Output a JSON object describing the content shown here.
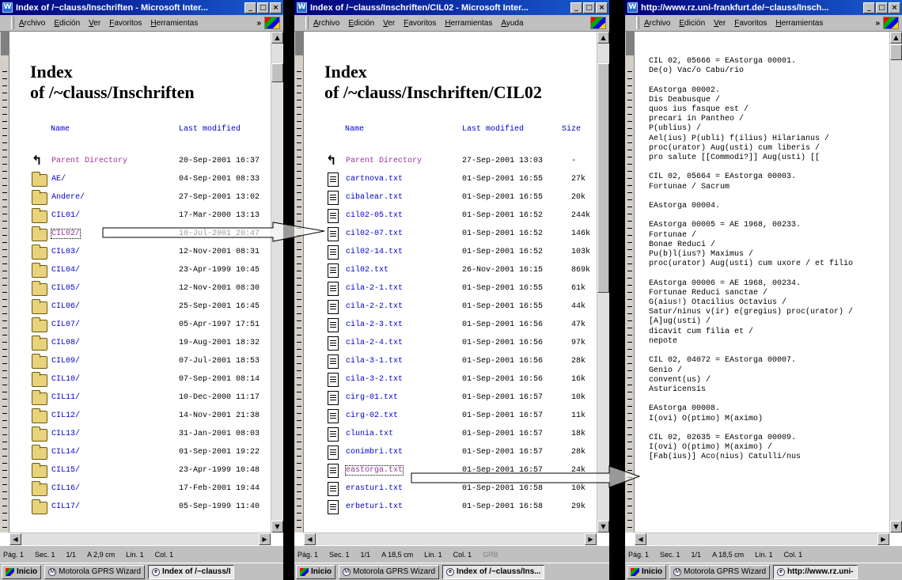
{
  "windows": [
    {
      "title": "Index of /~clauss/Inschriften - Microsoft Inter...",
      "menu": [
        "Archivo",
        "Edición",
        "Ver",
        "Favoritos",
        "Herramientas",
        "»"
      ],
      "heading1": "Index",
      "heading2": "of /~clauss/Inschriften",
      "col_name": "Name",
      "col_modified": "Last modified",
      "rows": [
        {
          "icon": "back",
          "name": "Parent Directory",
          "date": "20-Sep-2001 16:37"
        },
        {
          "icon": "folder",
          "name": "AE/",
          "date": "04-Sep-2001 08:33"
        },
        {
          "icon": "folder",
          "name": "Andere/",
          "date": "27-Sep-2001 13:02"
        },
        {
          "icon": "folder",
          "name": "CIL01/",
          "date": "17-Mar-2000 13:13"
        },
        {
          "icon": "folder",
          "name": "CIL02/",
          "date": "10-Jul-2001 20:47"
        },
        {
          "icon": "folder",
          "name": "CIL03/",
          "date": "12-Nov-2001 08:31"
        },
        {
          "icon": "folder",
          "name": "CIL04/",
          "date": "23-Apr-1999 10:45"
        },
        {
          "icon": "folder",
          "name": "CIL05/",
          "date": "12-Nov-2001 08:30"
        },
        {
          "icon": "folder",
          "name": "CIL06/",
          "date": "25-Sep-2001 16:45"
        },
        {
          "icon": "folder",
          "name": "CIL07/",
          "date": "05-Apr-1997 17:51"
        },
        {
          "icon": "folder",
          "name": "CIL08/",
          "date": "19-Aug-2001 18:32"
        },
        {
          "icon": "folder",
          "name": "CIL09/",
          "date": "07-Jul-2001 18:53"
        },
        {
          "icon": "folder",
          "name": "CIL10/",
          "date": "07-Sep-2001 08:14"
        },
        {
          "icon": "folder",
          "name": "CIL11/",
          "date": "10-Dec-2000 11:17"
        },
        {
          "icon": "folder",
          "name": "CIL12/",
          "date": "14-Nov-2001 21:38"
        },
        {
          "icon": "folder",
          "name": "CIL13/",
          "date": "31-Jan-2001 08:03"
        },
        {
          "icon": "folder",
          "name": "CIL14/",
          "date": "01-Sep-2001 19:22"
        },
        {
          "icon": "folder",
          "name": "CIL15/",
          "date": "23-Apr-1999 10:48"
        },
        {
          "icon": "folder",
          "name": "CIL16/",
          "date": "17-Feb-2001 19:44"
        },
        {
          "icon": "folder",
          "name": "CIL17/",
          "date": "05-Sep-1999 11:40"
        }
      ],
      "status": [
        "Pág. 1",
        "Sec. 1",
        "1/1",
        "A 2,9 cm",
        "Lín. 1",
        "Col. 1"
      ],
      "taskbar": [
        "Inicio",
        "Motorola GPRS Wizard",
        "Index of /~clauss/I"
      ]
    },
    {
      "title": "Index of /~clauss/Inschriften/CIL02 - Microsoft Inter...",
      "menu": [
        "Archivo",
        "Edición",
        "Ver",
        "Favoritos",
        "Herramientas",
        "Ayuda"
      ],
      "heading1": "Index",
      "heading2": "of /~clauss/Inschriften/CIL02",
      "col_name": "Name",
      "col_modified": "Last modified",
      "col_size": "Size",
      "rows": [
        {
          "icon": "back",
          "name": "Parent Directory",
          "date": "27-Sep-2001 13:03",
          "size": "-"
        },
        {
          "icon": "doc",
          "name": "cartnova.txt",
          "date": "01-Sep-2001 16:55",
          "size": "27k"
        },
        {
          "icon": "doc",
          "name": "cibalear.txt",
          "date": "01-Sep-2001 16:55",
          "size": "20k"
        },
        {
          "icon": "doc",
          "name": "cil02-05.txt",
          "date": "01-Sep-2001 16:52",
          "size": "244k"
        },
        {
          "icon": "doc",
          "name": "cil02-07.txt",
          "date": "01-Sep-2001 16:52",
          "size": "146k"
        },
        {
          "icon": "doc",
          "name": "cil02-14.txt",
          "date": "01-Sep-2001 16:52",
          "size": "103k"
        },
        {
          "icon": "doc",
          "name": "cil02.txt",
          "date": "26-Nov-2001 16:15",
          "size": "869k"
        },
        {
          "icon": "doc",
          "name": "cila-2-1.txt",
          "date": "01-Sep-2001 16:55",
          "size": "61k"
        },
        {
          "icon": "doc",
          "name": "cila-2-2.txt",
          "date": "01-Sep-2001 16:55",
          "size": "44k"
        },
        {
          "icon": "doc",
          "name": "cila-2-3.txt",
          "date": "01-Sep-2001 16:56",
          "size": "47k"
        },
        {
          "icon": "doc",
          "name": "cila-2-4.txt",
          "date": "01-Sep-2001 16:56",
          "size": "97k"
        },
        {
          "icon": "doc",
          "name": "cila-3-1.txt",
          "date": "01-Sep-2001 16:56",
          "size": "28k"
        },
        {
          "icon": "doc",
          "name": "cila-3-2.txt",
          "date": "01-Sep-2001 16:56",
          "size": "16k"
        },
        {
          "icon": "doc",
          "name": "cirg-01.txt",
          "date": "01-Sep-2001 16:57",
          "size": "10k"
        },
        {
          "icon": "doc",
          "name": "cirg-02.txt",
          "date": "01-Sep-2001 16:57",
          "size": "11k"
        },
        {
          "icon": "doc",
          "name": "clunia.txt",
          "date": "01-Sep-2001 16:57",
          "size": "18k"
        },
        {
          "icon": "doc",
          "name": "conimbri.txt",
          "date": "01-Sep-2001 16:57",
          "size": "28k"
        },
        {
          "icon": "doc",
          "name": "eastorga.txt",
          "date": "01-Sep-2001 16:57",
          "size": "24k"
        },
        {
          "icon": "doc",
          "name": "erasturi.txt",
          "date": "01-Sep-2001 16:58",
          "size": "10k"
        },
        {
          "icon": "doc",
          "name": "erbeturi.txt",
          "date": "01-Sep-2001 16:58",
          "size": "29k"
        }
      ],
      "status": [
        "Pág. 1",
        "Sec. 1",
        "1/1",
        "A 18,5 cm",
        "Lín. 1",
        "Col. 1",
        "GRB"
      ],
      "taskbar": [
        "Inicio",
        "Motorola GPRS Wizard",
        "Index of /~clauss/Ins..."
      ]
    },
    {
      "title": "http://www.rz.uni-frankfurt.de/~clauss/Insch...",
      "menu": [
        "Archivo",
        "Edición",
        "Ver",
        "Favoritos",
        "Herramientas",
        "»"
      ],
      "text": "CIL 02, 05666 = EAstorga 00001.\nDe(o) Vac/o Cabu/rio\n\nEAstorga 00002.\nDis Deabusque /\nquos ius fasque est /\nprecari in Pantheo /\nP(ublius) /\nAel(ius) P(ubli) f(ilius) Hilarianus /\nproc(urator) Aug(usti) cum liberis /\npro salute [[Commodi?]] Aug(usti) [[\n\nCIL 02, 05664 = EAstorga 00003.\nFortunae / Sacrum\n\nEAstorga 00004.\n\nEAstorga 00005 = AE 1968, 00233.\nFortunae /\nBonae Reduci /\nPu(b)l(ius?) Maximus /\nproc(urator) Aug(usti) cum uxore / et filio\n\nEAstorga 00006 = AE 1968, 00234.\nFortunae Reduci sanctae /\nG(aius!) Otacilius Octavius /\nSatur/ninus v(ir) e(gregius) proc(urator) /\n[A]ug(usti) /\ndicavit cum filia et /\nnepote\n\nCIL 02, 04072 = EAstorga 00007.\nGenio /\nconvent(us) /\nAsturicensis\n\nEAstorga 00008.\nI(ovi) O(ptimo) M(aximo)\n\nCIL 02, 02635 = EAstorga 00009.\nI(ovi) O(ptimo) M(aximo) /\n[Fab(ius)] Aco(nius) Catulli/nus",
      "status": [
        "Pág. 1",
        "Sec. 1",
        "1/1",
        "A 18,5 cm",
        "Lín. 1",
        "Col. 1"
      ],
      "taskbar": [
        "Inicio",
        "Motorola GPRS Wizard",
        "http://www.rz.uni-"
      ]
    }
  ],
  "colors": {
    "link": "#0000cc",
    "visited": "#993399",
    "titlebar": "#00007b",
    "chrome": "#c0c0c0"
  }
}
